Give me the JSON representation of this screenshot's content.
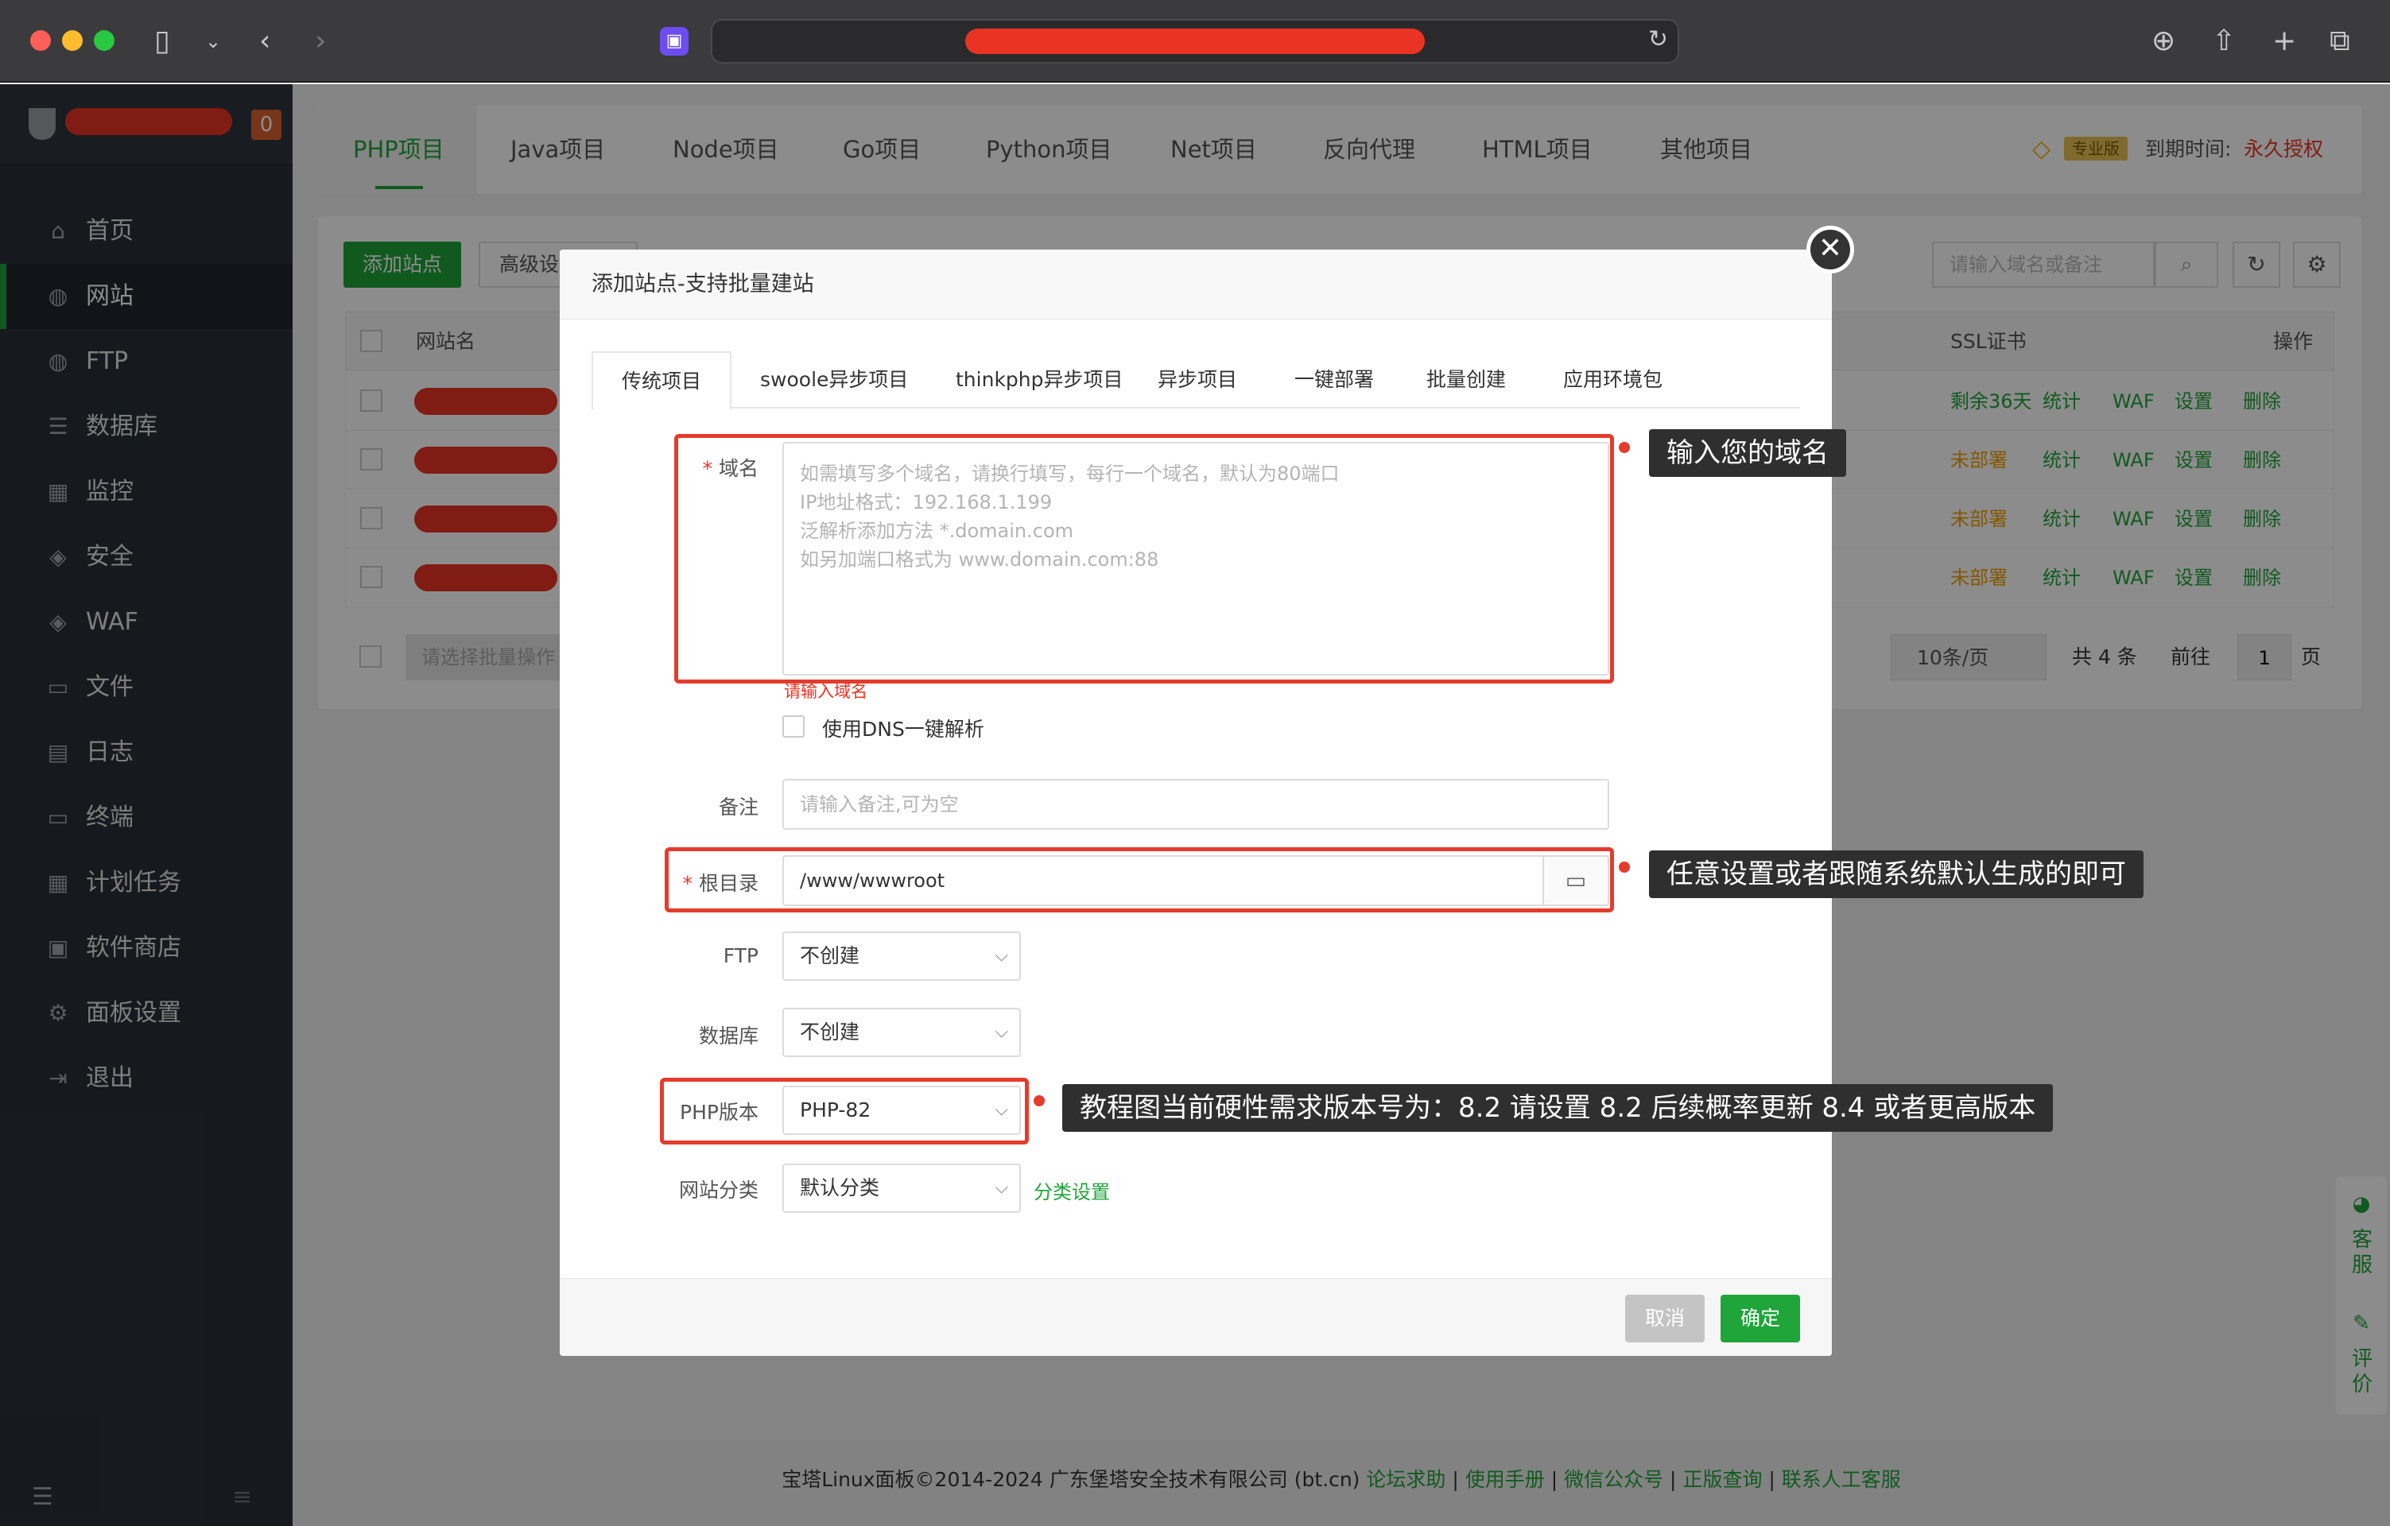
{
  "browser": {
    "icons": [
      "sidebar-toggle-icon",
      "chevron-down-icon",
      "back-icon",
      "forward-icon",
      "reload-icon",
      "download-icon",
      "share-icon",
      "plus-icon",
      "tabs-icon"
    ]
  },
  "sidebar": {
    "badge": "0",
    "items": [
      {
        "label": "首页",
        "icon": "⌂"
      },
      {
        "label": "网站",
        "icon": "◍"
      },
      {
        "label": "FTP",
        "icon": "◍"
      },
      {
        "label": "数据库",
        "icon": "☰"
      },
      {
        "label": "监控",
        "icon": "▦"
      },
      {
        "label": "安全",
        "icon": "◈"
      },
      {
        "label": "WAF",
        "icon": "◈"
      },
      {
        "label": "文件",
        "icon": "▭"
      },
      {
        "label": "日志",
        "icon": "▤"
      },
      {
        "label": "终端",
        "icon": "▭"
      },
      {
        "label": "计划任务",
        "icon": "▦"
      },
      {
        "label": "软件商店",
        "icon": "▣"
      },
      {
        "label": "面板设置",
        "icon": "⚙"
      },
      {
        "label": "退出",
        "icon": "⇥"
      }
    ]
  },
  "project_tabs": [
    "PHP项目",
    "Java项目",
    "Node项目",
    "Go项目",
    "Python项目",
    "Net项目",
    "反向代理",
    "HTML项目",
    "其他项目"
  ],
  "license": {
    "badge": "专业版",
    "label": "到期时间:",
    "value": "永久授权"
  },
  "site_list": {
    "add_button": "添加站点",
    "advanced_button": "高级设",
    "search_placeholder": "请输入域名或备注",
    "col_name": "网站名",
    "col_ssl": "SSL证书",
    "col_ops": "操作",
    "rows": [
      {
        "ssl": "剩余36天",
        "ops": [
          "统计",
          "WAF",
          "设置",
          "删除"
        ]
      },
      {
        "ssl": "未部署",
        "ops": [
          "统计",
          "WAF",
          "设置",
          "删除"
        ]
      },
      {
        "ssl": "未部署",
        "ops": [
          "统计",
          "WAF",
          "设置",
          "删除"
        ]
      },
      {
        "ssl": "未部署",
        "ops": [
          "统计",
          "WAF",
          "设置",
          "删除"
        ]
      }
    ],
    "batch_placeholder": "请选择批量操作",
    "page_size": "10条/页",
    "total": "共 4 条",
    "goto": "前往",
    "page": "1",
    "page_suffix": "页"
  },
  "modal": {
    "title": "添加站点-支持批量建站",
    "tabs": [
      "传统项目",
      "swoole异步项目",
      "thinkphp异步项目",
      "异步项目",
      "一键部署",
      "批量创建",
      "应用环境包"
    ],
    "domain_label": "域名",
    "domain_placeholder_lines": [
      "如需填写多个域名，请换行填写，每行一个域名，默认为80端口",
      "IP地址格式：192.168.1.199",
      "泛解析添加方法 *.domain.com",
      "如另加端口格式为 www.domain.com:88"
    ],
    "domain_error": "请输入域名",
    "dns_checkbox": "使用DNS一键解析",
    "remark_label": "备注",
    "remark_placeholder": "请输入备注,可为空",
    "root_label": "根目录",
    "root_value": "/www/wwwroot",
    "ftp_label": "FTP",
    "ftp_value": "不创建",
    "db_label": "数据库",
    "db_value": "不创建",
    "php_label": "PHP版本",
    "php_value": "PHP-82",
    "category_label": "网站分类",
    "category_value": "默认分类",
    "category_link": "分类设置",
    "cancel": "取消",
    "confirm": "确定"
  },
  "annotations": {
    "domain": "输入您的域名",
    "root": "任意设置或者跟随系统默认生成的即可",
    "php": "教程图当前硬性需求版本号为：8.2 请设置 8.2 后续概率更新 8.4 或者更高版本"
  },
  "float_panel": {
    "service": "客服",
    "review": "评价"
  },
  "footer": {
    "copyright": "宝塔Linux面板©2014-2024 广东堡塔安全技术有限公司 (bt.cn)",
    "links": [
      "论坛求助",
      "使用手册",
      "微信公众号",
      "正版查询",
      "联系人工客服"
    ]
  }
}
